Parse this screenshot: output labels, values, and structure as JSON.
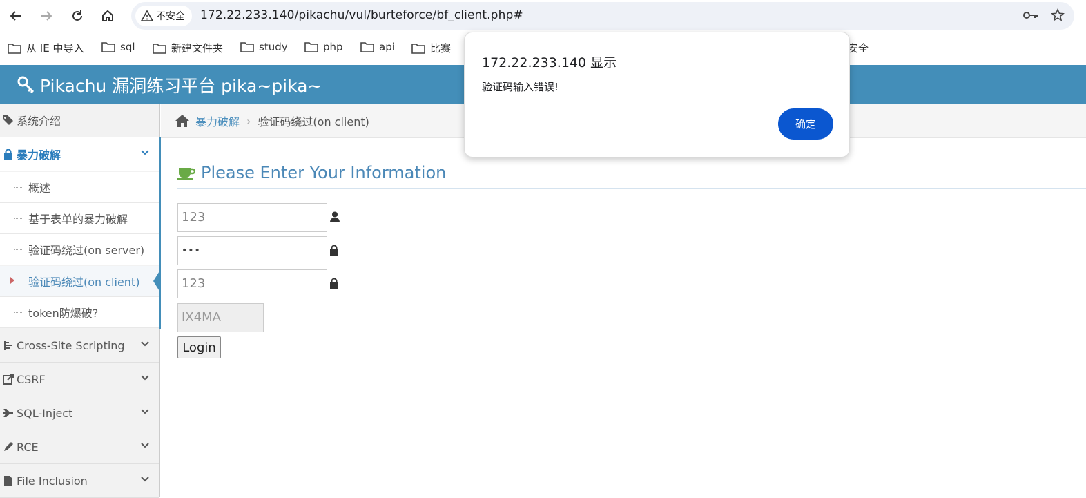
{
  "browser": {
    "security_label": "不安全",
    "url": "172.22.233.140/pikachu/vul/burteforce/bf_client.php#",
    "icons": [
      "back-icon",
      "forward-icon",
      "reload-icon",
      "home-icon",
      "warning-icon",
      "key-icon",
      "star-icon"
    ]
  },
  "bookmarks": [
    {
      "label": "从 IE 中导入"
    },
    {
      "label": "sql"
    },
    {
      "label": "新建文件夹"
    },
    {
      "label": "study"
    },
    {
      "label": "php"
    },
    {
      "label": "api"
    },
    {
      "label": "比赛"
    },
    {
      "label": "安全"
    }
  ],
  "app": {
    "title": "Pikachu 漏洞练习平台 pika~pika~",
    "accent_color": "#438eb9"
  },
  "sidebar": {
    "items": [
      {
        "label": "系统介绍",
        "icon": "tags-icon"
      },
      {
        "label": "暴力破解",
        "icon": "lock-icon",
        "expanded": true
      },
      {
        "label": "Cross-Site Scripting",
        "icon": "xss-icon"
      },
      {
        "label": "CSRF",
        "icon": "share-icon"
      },
      {
        "label": "SQL-Inject",
        "icon": "plane-icon"
      },
      {
        "label": "RCE",
        "icon": "pencil-icon"
      },
      {
        "label": "File Inclusion",
        "icon": "file-icon"
      }
    ],
    "subitems": [
      {
        "label": "概述"
      },
      {
        "label": "基于表单的暴力破解"
      },
      {
        "label": "验证码绕过(on server)"
      },
      {
        "label": "验证码绕过(on client)",
        "current": true
      },
      {
        "label": "token防爆破?"
      }
    ]
  },
  "breadcrumb": {
    "parent": "暴力破解",
    "current": "验证码绕过(on client)"
  },
  "form": {
    "heading": "Please Enter Your Information",
    "username_value": "123",
    "password_value": "•••",
    "captcha_input_value": "123",
    "captcha_code": "IX4MA",
    "login_label": "Login"
  },
  "dialog": {
    "title": "172.22.233.140 显示",
    "message": "验证码输入错误!",
    "ok_label": "确定",
    "button_color": "#0b57d0"
  }
}
